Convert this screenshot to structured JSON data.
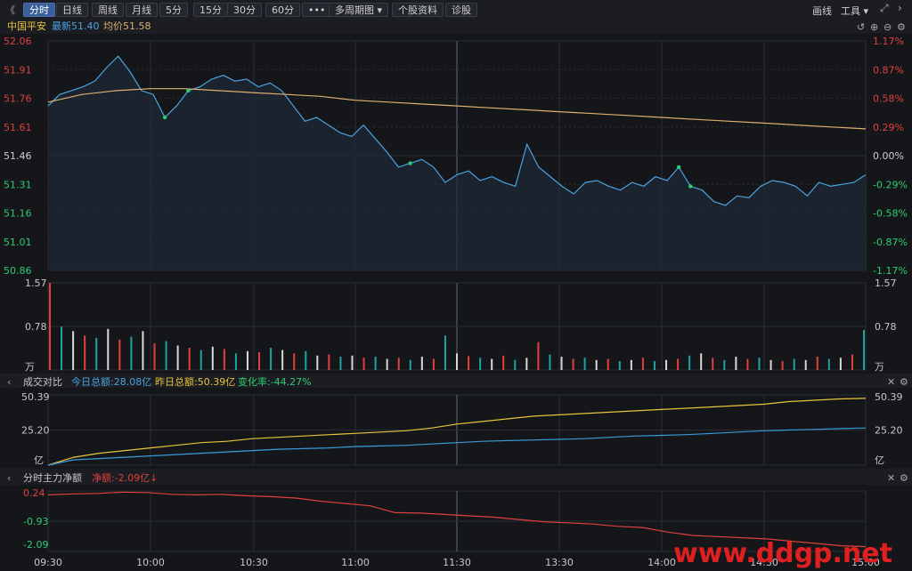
{
  "toolbar": {
    "back_label": "《",
    "tabs": [
      "分时",
      "日线",
      "周线",
      "月线",
      "5分",
      "15分",
      "30分",
      "60分",
      "•••",
      "多周期图 ▾",
      "个股资料",
      "诊股"
    ],
    "active_tab": 0,
    "right_items": [
      "画线",
      "工具 ▾"
    ]
  },
  "colors": {
    "price": "#4aa3df",
    "avg": "#e0b070",
    "up": "#e04040",
    "down": "#2ecc71",
    "yellow": "#e8c43a",
    "grid": "#2a2d33"
  },
  "price_header": {
    "stock": "中国平安",
    "latest_label": "最新",
    "latest": "51.40",
    "avg_label": "均价",
    "avg": "51.58"
  },
  "turnover_header": {
    "title": "成交对比",
    "today_label": "今日总额:",
    "today": "28.08亿",
    "yesterday_label": "昨日总额:",
    "yesterday": "50.39亿",
    "change_label": "变化率:",
    "change": "-44.27%"
  },
  "flow_header": {
    "title": "分时主力净额",
    "net_label": "净额:",
    "net": "-2.09亿↓"
  },
  "watermark": "www.ddgp.net",
  "chart_data": [
    {
      "type": "line",
      "title": "",
      "x": [
        "09:30",
        "10:00",
        "10:30",
        "11:00",
        "11:30",
        "13:30",
        "14:00",
        "14:30",
        "15:00"
      ],
      "y_ticks": [
        "52.06",
        "51.91",
        "51.76",
        "51.61",
        "51.46",
        "51.31",
        "51.16",
        "51.01",
        "50.86"
      ],
      "pct_ticks": [
        "1.17%",
        "0.87%",
        "0.58%",
        "0.29%",
        "0.00%",
        "-0.29%",
        "-0.58%",
        "-0.87%",
        "-1.17%"
      ],
      "ylim": [
        50.86,
        52.06
      ],
      "series": [
        {
          "name": "最新",
          "values": [
            51.72,
            51.78,
            51.8,
            51.82,
            51.85,
            51.92,
            51.98,
            51.9,
            51.8,
            51.78,
            51.66,
            51.72,
            51.8,
            51.82,
            51.86,
            51.88,
            51.85,
            51.86,
            51.82,
            51.84,
            51.8,
            51.72,
            51.64,
            51.66,
            51.62,
            51.58,
            51.56,
            51.62,
            51.55,
            51.48,
            51.4,
            51.42,
            51.44,
            51.4,
            51.32,
            51.36,
            51.38,
            51.33,
            51.35,
            51.32,
            51.3,
            51.52,
            51.4,
            51.35,
            51.3,
            51.26,
            51.32,
            51.33,
            51.3,
            51.28,
            51.32,
            51.3,
            51.35,
            51.33,
            51.4,
            51.3,
            51.28,
            51.22,
            51.2,
            51.25,
            51.24,
            51.3,
            51.33,
            51.32,
            51.3,
            51.25,
            51.32,
            51.3,
            51.31,
            51.32,
            51.36
          ]
        },
        {
          "name": "均价",
          "values": [
            51.74,
            51.78,
            51.8,
            51.81,
            51.81,
            51.8,
            51.79,
            51.78,
            51.77,
            51.75,
            51.74,
            51.73,
            51.72,
            51.71,
            51.7,
            51.69,
            51.68,
            51.67,
            51.66,
            51.65,
            51.64,
            51.63,
            51.62,
            51.61,
            51.6
          ]
        }
      ]
    },
    {
      "type": "bar",
      "title": "",
      "y_ticks": [
        "1.57",
        "0.78",
        "万"
      ],
      "ylim": [
        0,
        1.57
      ],
      "values": [
        1.57,
        0.78,
        0.7,
        0.62,
        0.58,
        0.74,
        0.55,
        0.6,
        0.7,
        0.48,
        0.52,
        0.44,
        0.4,
        0.36,
        0.42,
        0.38,
        0.3,
        0.34,
        0.32,
        0.4,
        0.36,
        0.3,
        0.34,
        0.26,
        0.28,
        0.24,
        0.26,
        0.22,
        0.24,
        0.2,
        0.22,
        0.18,
        0.24,
        0.2,
        0.62,
        0.3,
        0.25,
        0.22,
        0.2,
        0.26,
        0.18,
        0.22,
        0.5,
        0.28,
        0.24,
        0.2,
        0.22,
        0.18,
        0.2,
        0.16,
        0.18,
        0.22,
        0.16,
        0.18,
        0.2,
        0.26,
        0.3,
        0.22,
        0.18,
        0.24,
        0.2,
        0.22,
        0.18,
        0.16,
        0.2,
        0.18,
        0.24,
        0.2,
        0.22,
        0.28,
        0.72
      ]
    },
    {
      "type": "line",
      "title": "",
      "y_ticks": [
        "50.39",
        "25.20",
        "亿"
      ],
      "ylim": [
        0,
        50.39
      ],
      "series": [
        {
          "name": "昨日总额",
          "values": [
            0,
            6,
            9,
            11,
            13,
            15,
            17,
            18,
            20,
            21,
            22,
            23,
            24,
            25,
            26,
            28,
            31,
            33,
            35,
            37,
            38,
            39,
            40,
            41,
            42,
            43,
            44,
            45,
            46,
            48,
            49,
            50,
            50.39
          ]
        },
        {
          "name": "今日总额",
          "values": [
            0,
            4,
            5,
            6,
            7,
            8,
            9,
            10,
            11,
            12,
            12.5,
            13,
            14,
            14.5,
            15,
            16,
            17,
            18,
            18.5,
            19,
            19.5,
            20,
            21,
            22,
            22.5,
            23,
            24,
            25,
            26,
            26.5,
            27,
            27.6,
            28.08
          ]
        }
      ]
    },
    {
      "type": "line",
      "title": "",
      "y_ticks": [
        "0.24",
        "-0.93",
        "-2.09"
      ],
      "ylim": [
        -2.3,
        0.35
      ],
      "series": [
        {
          "name": "净额",
          "values": [
            0.18,
            0.22,
            0.24,
            0.3,
            0.28,
            0.2,
            0.18,
            0.2,
            0.14,
            0.1,
            0.04,
            -0.1,
            -0.2,
            -0.3,
            -0.6,
            -0.62,
            -0.68,
            -0.74,
            -0.8,
            -0.9,
            -1.0,
            -1.05,
            -1.1,
            -1.2,
            -1.25,
            -1.45,
            -1.6,
            -1.65,
            -1.7,
            -1.75,
            -1.85,
            -1.95,
            -2.05,
            -2.09
          ]
        }
      ]
    }
  ]
}
